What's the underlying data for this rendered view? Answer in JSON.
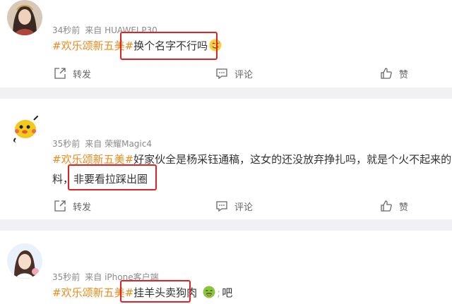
{
  "posts": [
    {
      "meta": {
        "time": "34秒前",
        "source": "来自 HUAWEI P30"
      },
      "hashtag": "#欢乐颂新五美#",
      "text_main": "换个名字不行吗",
      "emoji": "sweat-smile-emoji",
      "actions": {
        "repost": "转发",
        "comment": "评论",
        "like": "赞"
      }
    },
    {
      "meta": {
        "time": "35秒前",
        "source": "来自 荣耀Magic4"
      },
      "hashtag": "#欢乐颂新五美#",
      "line1": "好家伙全是杨采钰通稿，这女的还没放弃挣扎吗，就是个火不起来的",
      "line2_prefix": "料，",
      "line2_boxed": "非要看拉踩出圈",
      "actions": {
        "repost": "转发",
        "comment": "评论",
        "like": "赞"
      }
    },
    {
      "meta": {
        "time": "35秒前",
        "source": "来自 iPhone客户端"
      },
      "hashtag": "#欢乐颂新五美#",
      "text_boxed": "挂羊头卖狗肉",
      "emoji": "nauseated-face-emoji",
      "tail": "吧"
    }
  ],
  "colors": {
    "hashtag": "#f08a1c",
    "highlight_box": "#e02222",
    "divider": "#f1f1f3"
  }
}
